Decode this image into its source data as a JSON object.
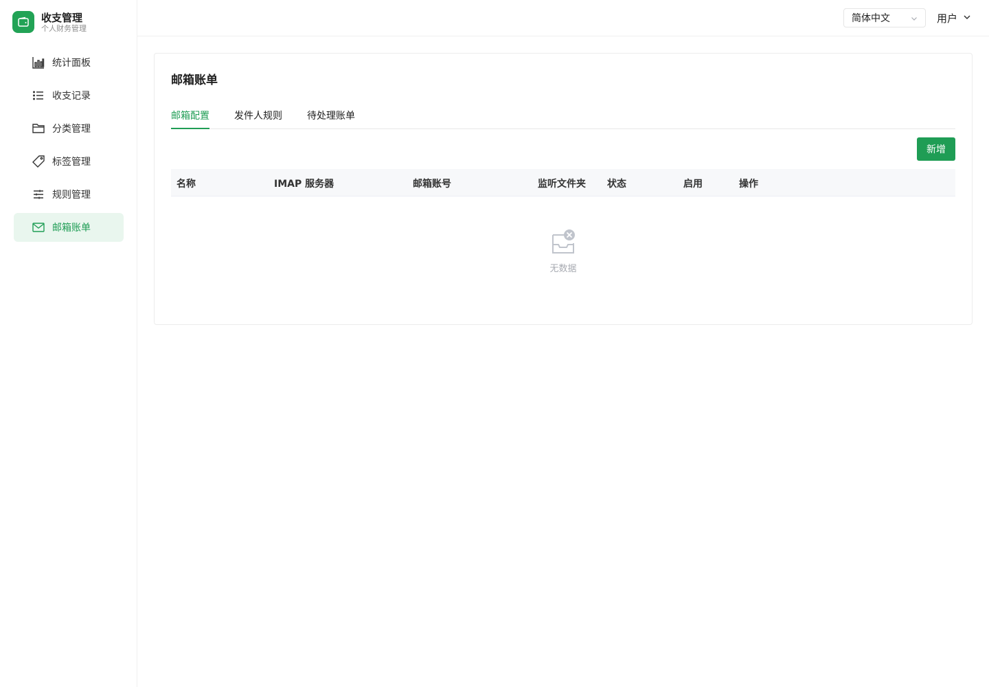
{
  "brand": {
    "title": "收支管理",
    "subtitle": "个人财务管理",
    "logo_icon": "wallet-icon",
    "color": "#22a356"
  },
  "sidebar": {
    "items": [
      {
        "label": "统计面板",
        "icon": "bar-chart-icon",
        "active": false
      },
      {
        "label": "收支记录",
        "icon": "list-icon",
        "active": false
      },
      {
        "label": "分类管理",
        "icon": "folder-icon",
        "active": false
      },
      {
        "label": "标签管理",
        "icon": "tag-icon",
        "active": false
      },
      {
        "label": "规则管理",
        "icon": "sliders-icon",
        "active": false
      },
      {
        "label": "邮箱账单",
        "icon": "mail-icon",
        "active": true
      }
    ]
  },
  "header": {
    "language": "简体中文",
    "user": "用户"
  },
  "main": {
    "title": "邮箱账单",
    "tabs": [
      {
        "label": "邮箱配置",
        "active": true
      },
      {
        "label": "发件人规则",
        "active": false
      },
      {
        "label": "待处理账单",
        "active": false
      }
    ],
    "add_label": "新增",
    "table": {
      "columns": [
        "名称",
        "IMAP 服务器",
        "邮箱账号",
        "监听文件夹",
        "状态",
        "启用",
        "操作"
      ],
      "rows": [],
      "empty_text": "无数据"
    }
  },
  "colors": {
    "accent": "#1f9d55",
    "active_bg": "#e9f6ee"
  }
}
